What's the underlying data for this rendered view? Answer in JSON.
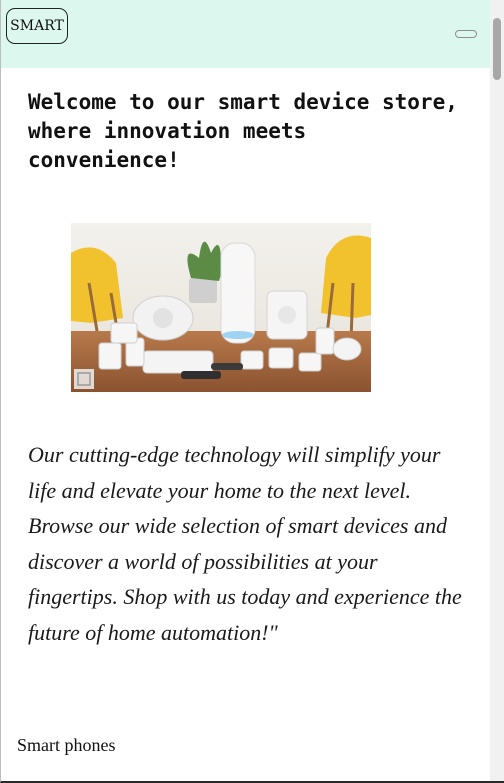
{
  "navbar": {
    "brand_label": "SMART"
  },
  "main": {
    "headline": "Welcome to our smart device store, where innovation meets convenience!",
    "tagline": "Our cutting-edge technology will simplify your life and elevate your home to the next level. Browse our wide selection of smart devices and discover a world of possibilities at your fingertips. Shop with us today and experience the future of home automation!\"",
    "section_label": "Smart phones"
  },
  "colors": {
    "navbar_bg": "#dcf7ee",
    "text": "#111111"
  },
  "icons": {
    "menu_toggle": "hamburger-toggle-icon"
  }
}
